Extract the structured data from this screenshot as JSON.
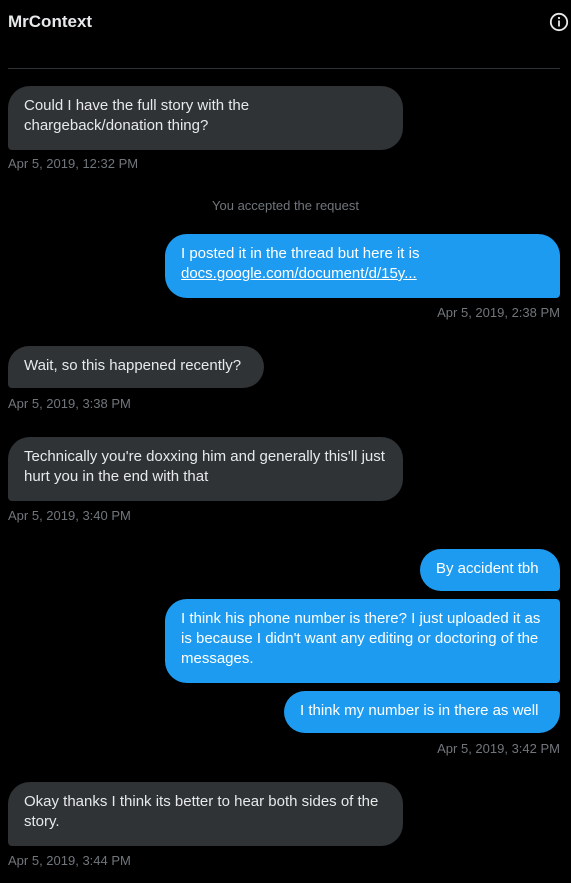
{
  "header": {
    "title": "MrContext",
    "info_icon": "info-circle-icon"
  },
  "conversation": {
    "system_notice": "You accepted the request",
    "messages": [
      {
        "side": "incoming",
        "text": "Could I have the full story with the chargeback/donation thing?",
        "timestamp": "Apr 5, 2019, 12:32 PM"
      },
      {
        "side": "outgoing",
        "text": "I posted it in the thread but here it is",
        "link": "docs.google.com/document/d/15y...",
        "timestamp": "Apr 5, 2019, 2:38 PM"
      },
      {
        "side": "incoming",
        "text": "Wait, so this happened recently?",
        "timestamp": "Apr 5, 2019, 3:38 PM"
      },
      {
        "side": "incoming",
        "text": "Technically you're doxxing him and generally this'll just hurt you in the end with that",
        "timestamp": "Apr 5, 2019, 3:40 PM"
      },
      {
        "side": "outgoing",
        "text": "By accident tbh"
      },
      {
        "side": "outgoing",
        "text": "I think his phone number is there? I just uploaded it as is because I didn't want any editing or doctoring of the messages."
      },
      {
        "side": "outgoing",
        "text": "I think my number is in there as well",
        "timestamp": "Apr 5, 2019, 3:42 PM"
      },
      {
        "side": "incoming",
        "text": "Okay thanks I think its better to hear both sides of the story.",
        "timestamp": "Apr 5, 2019, 3:44 PM"
      }
    ]
  },
  "colors": {
    "background": "#000000",
    "incoming_bubble": "#2f3336",
    "outgoing_bubble": "#1d9bf0",
    "timestamp": "#71767b"
  }
}
